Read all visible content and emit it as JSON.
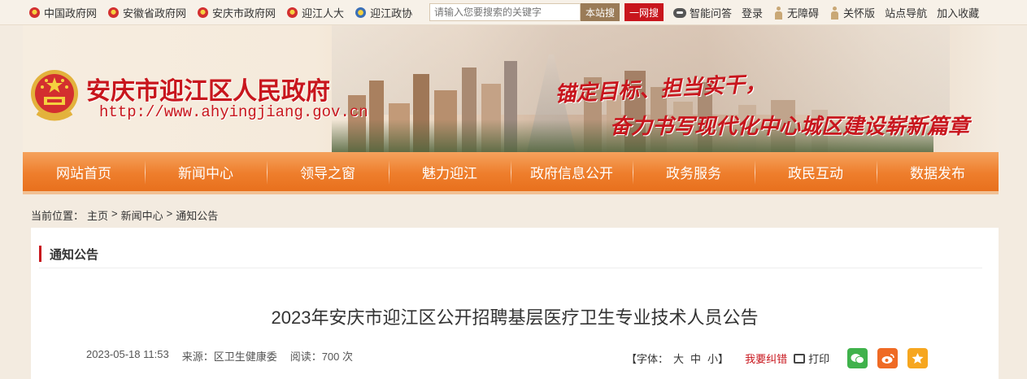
{
  "topbar": {
    "links": [
      "中国政府网",
      "安徽省政府网",
      "安庆市政府网",
      "迎江人大",
      "迎江政协"
    ],
    "search_placeholder": "请输入您要搜索的关键字",
    "search_site_label": "本站搜",
    "search_net_label": "一网搜",
    "right_links": {
      "qa": "智能问答",
      "login": "登录",
      "accessible": "无障碍",
      "care": "关怀版",
      "sitemap": "站点导航",
      "favorite": "加入收藏"
    }
  },
  "banner": {
    "title": "安庆市迎江区人民政府",
    "url": "http://www.ahyingjiang.gov.cn",
    "slogan_line1": "锚定目标、担当实干，",
    "slogan_line2": "奋力书写现代化中心城区建设崭新篇章"
  },
  "nav": [
    "网站首页",
    "新闻中心",
    "领导之窗",
    "魅力迎江",
    "政府信息公开",
    "政务服务",
    "政民互动",
    "数据发布"
  ],
  "breadcrumb": {
    "prefix": "当前位置：",
    "items": [
      "主页",
      "新闻中心",
      "通知公告"
    ],
    "separator": ">"
  },
  "section": {
    "title": "通知公告"
  },
  "article": {
    "title": "2023年安庆市迎江区公开招聘基层医疗卫生专业技术人员公告",
    "date": "2023-05-18 11:53",
    "source": "来源：区卫生健康委",
    "views": "阅读：700 次",
    "font_label": "【字体：",
    "font_large": "大",
    "font_medium": "中",
    "font_small": "小】",
    "error_label": "我要纠错",
    "print_label": "打印"
  },
  "colors": {
    "brand_red": "#c8161d",
    "nav_orange": "#ee7e2c",
    "wechat_green": "#3fb24b",
    "weibo_orange": "#ef6a24",
    "qzone_yellow": "#f6a61f"
  }
}
